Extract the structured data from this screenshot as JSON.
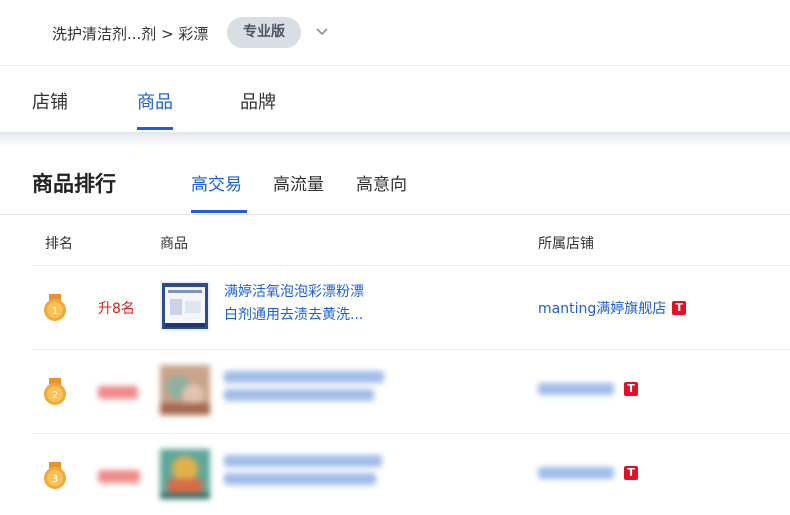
{
  "breadcrumb": {
    "path": "洗护清洁剂...剂 > 彩漂",
    "edition": "专业版"
  },
  "main_tabs": [
    {
      "label": "店铺",
      "active": false
    },
    {
      "label": "商品",
      "active": true
    },
    {
      "label": "品牌",
      "active": false
    }
  ],
  "ranking": {
    "title": "商品排行",
    "sub_tabs": [
      {
        "label": "高交易",
        "active": true
      },
      {
        "label": "高流量",
        "active": false
      },
      {
        "label": "高意向",
        "active": false
      }
    ],
    "columns": {
      "rank": "排名",
      "product": "商品",
      "shop": "所属店铺"
    },
    "rows": [
      {
        "rank": "1",
        "change": "升8名",
        "product_line1": "满婷活氧泡泡彩漂粉漂",
        "product_line2": "白剂通用去渍去黄洗...",
        "shop": "manting满婷旗舰店",
        "badge": "T",
        "blurred": false
      },
      {
        "rank": "2",
        "change": "",
        "product_line1": "",
        "product_line2": "",
        "shop": "",
        "badge": "T",
        "blurred": true
      },
      {
        "rank": "3",
        "change": "",
        "product_line1": "",
        "product_line2": "",
        "shop": "",
        "badge": "T",
        "blurred": true
      }
    ]
  },
  "colors": {
    "accent": "#1f5fd9",
    "rank_up": "#e02020",
    "tmall_badge": "#e3102a",
    "medal": "#f2a93b"
  }
}
